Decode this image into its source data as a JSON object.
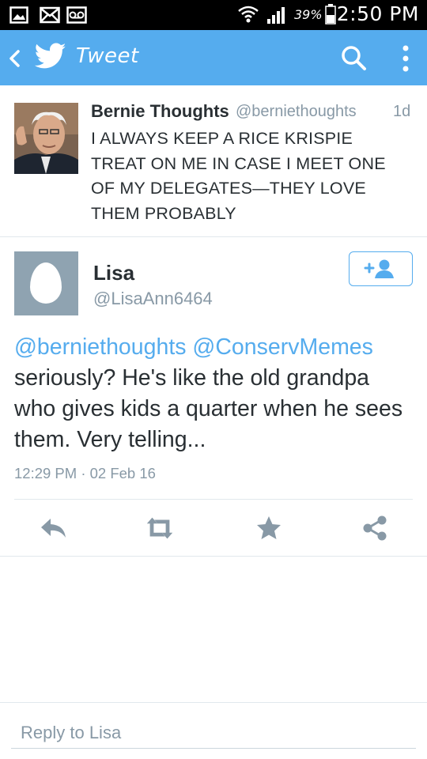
{
  "status_bar": {
    "battery_percent": "39%",
    "time": "2:50 PM"
  },
  "header": {
    "title": "Tweet",
    "back_icon": "chevron-left-icon",
    "logo_icon": "twitter-bird-icon",
    "search_icon": "search-icon",
    "menu_icon": "more-vertical-icon",
    "accent": "#55acee"
  },
  "quoted_tweet": {
    "author_name": "Bernie Thoughts",
    "author_handle": "@berniethoughts",
    "time_ago": "1d",
    "text": "I ALWAYS KEEP A RICE KRISPIE TREAT ON ME IN CASE I MEET ONE OF MY DELEGATES—THEY LOVE THEM PROBABLY"
  },
  "reply_tweet": {
    "author_name": "Lisa",
    "author_handle": "@LisaAnn6464",
    "mention_1": "@berniethoughts",
    "mention_2": "@ConservMemes",
    "body": "seriously?  He's like the old grandpa who gives kids a quarter when he sees them.  Very telling...",
    "timestamp": "12:29 PM · 02 Feb 16"
  },
  "actions": [
    "reply-icon",
    "retweet-icon",
    "favorite-icon",
    "share-icon"
  ],
  "compose": {
    "placeholder": "Reply to Lisa"
  }
}
